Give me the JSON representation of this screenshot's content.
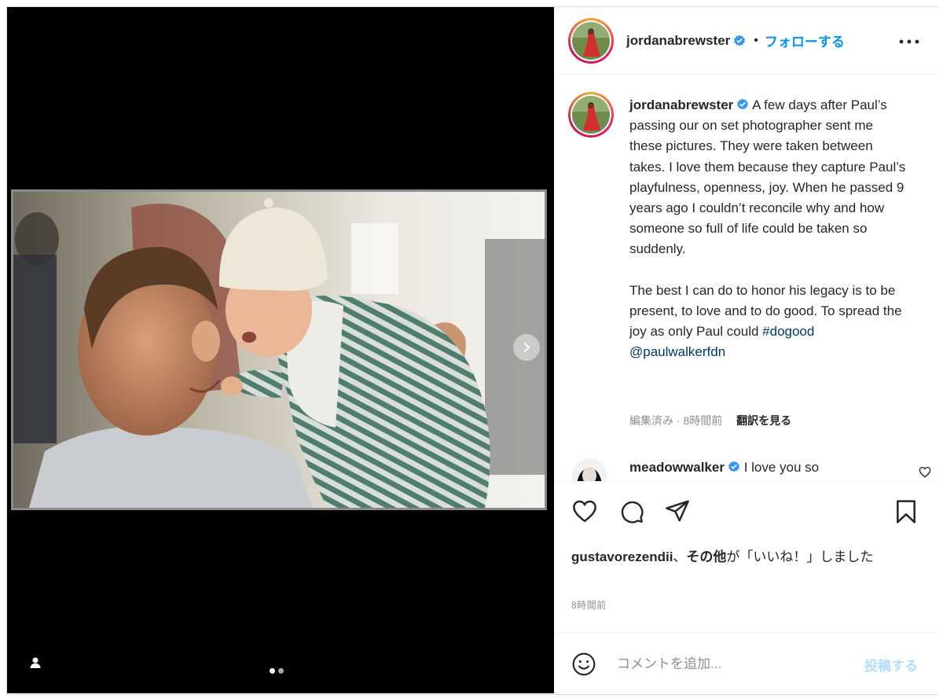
{
  "post": {
    "username": "jordanabrewster",
    "verified": true,
    "separator": "•",
    "follow_label": "フォローする",
    "more_label": "•••",
    "carousel": {
      "count": 2,
      "active": 0
    }
  },
  "caption": {
    "username": "jordanabrewster",
    "paragraph1": "A few days after Paul’s passing our on set photographer sent me these pictures. They were taken between takes. I love them because they capture Paul’s playfulness, openness, joy. When he passed 9 years ago I couldn’t reconcile why and how someone so full of life could be taken so suddenly.",
    "paragraph2_prefix": "The best I can do to honor his legacy is to be present, to love and to do good. To spread the joy as only Paul could ",
    "hashtag": "#dogood",
    "mention": "@paulwalkerfdn",
    "edited_time": "編集済み · 8時間前",
    "translate_label": "翻訳を見る"
  },
  "comment": {
    "username": "meadowwalker",
    "verified": true,
    "text": "I love you so"
  },
  "likes": {
    "liker": "gustavorezendii",
    "conjunction": "、",
    "others": "その他",
    "suffix": "が「いいね！」しました"
  },
  "timestamp": "8時間前",
  "add_comment": {
    "placeholder": "コメントを追加...",
    "post_label": "投稿する"
  },
  "colors": {
    "link": "#00376b",
    "follow": "#0095f6",
    "post_disabled": "#b2dffc",
    "verified": "#3897f0"
  }
}
